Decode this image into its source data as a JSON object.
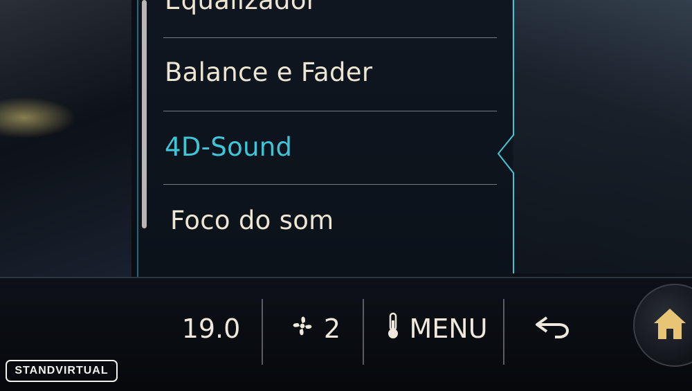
{
  "menu": {
    "items": [
      {
        "label": "Equalizador",
        "active": false
      },
      {
        "label": "Balance e Fader",
        "active": false
      },
      {
        "label": "4D-Sound",
        "active": true
      },
      {
        "label": "Foco do som",
        "active": false
      }
    ]
  },
  "bottom_bar": {
    "temperature": "19.0",
    "fan_level": "2",
    "menu_label": "MENU",
    "icons": [
      "fan-icon",
      "seat-heat-icon",
      "back-arrow-icon",
      "home-icon"
    ]
  },
  "watermark": {
    "text": "STANDVIRTUAL"
  },
  "colors": {
    "accent": "#3fc6d6",
    "text": "#ece6d2",
    "home_icon": "#e8c574"
  }
}
